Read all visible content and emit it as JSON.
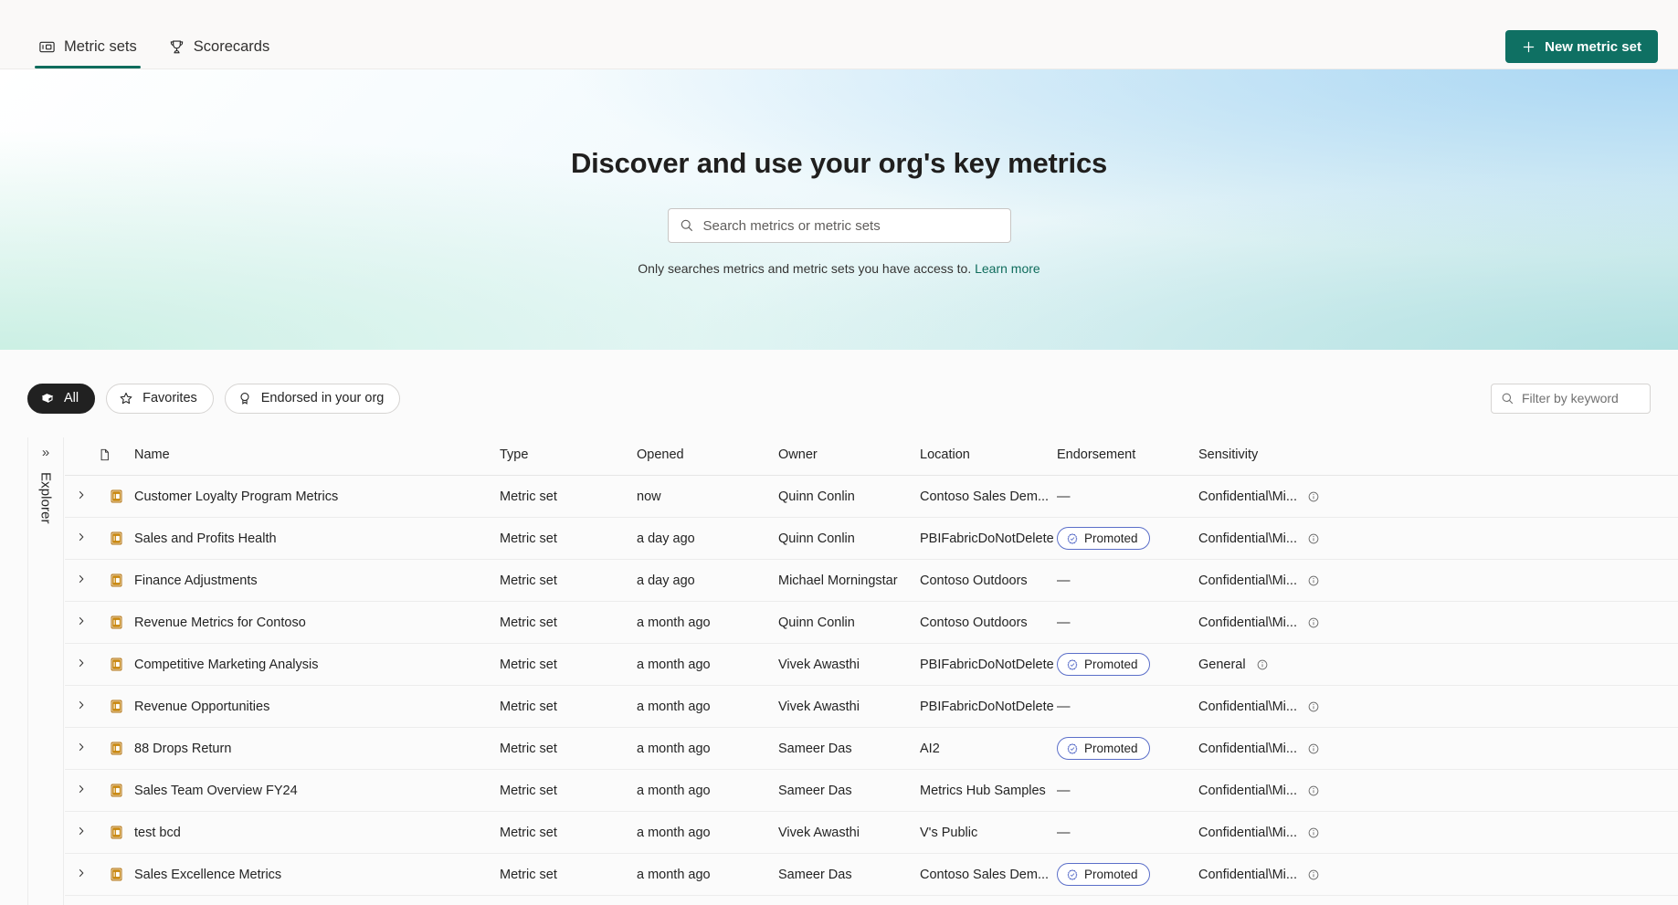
{
  "header": {
    "tabs": [
      {
        "label": "Metric sets",
        "icon": "metric-set-icon",
        "active": true
      },
      {
        "label": "Scorecards",
        "icon": "trophy-icon",
        "active": false
      }
    ],
    "new_button": {
      "label": "New metric set",
      "icon": "plus-icon",
      "color": "#0f7063"
    }
  },
  "hero": {
    "title": "Discover and use your org's key metrics",
    "search": {
      "placeholder": "Search metrics or metric sets",
      "value": "",
      "icon": "search-icon"
    },
    "note_text": "Only searches metrics and metric sets you have access to.",
    "note_link": "Learn more",
    "link_color": "#0f6c5c"
  },
  "explorer": {
    "label": "Explorer",
    "expand_icon": "chevron-double-right-icon"
  },
  "filters": {
    "pills": [
      {
        "label": "All",
        "icon": "collection-icon",
        "active": true
      },
      {
        "label": "Favorites",
        "icon": "star-icon",
        "active": false
      },
      {
        "label": "Endorsed in your org",
        "icon": "badge-icon",
        "active": false
      }
    ],
    "keyword": {
      "placeholder": "Filter by keyword",
      "value": "",
      "icon": "search-icon"
    }
  },
  "table": {
    "columns": [
      "",
      "",
      "Name",
      "Type",
      "Opened",
      "Owner",
      "Location",
      "Endorsement",
      "Sensitivity"
    ],
    "headers": {
      "name": "Name",
      "type": "Type",
      "opened": "Opened",
      "owner": "Owner",
      "location": "Location",
      "endorsement": "Endorsement",
      "sensitivity": "Sensitivity"
    },
    "rows": [
      {
        "name": "Customer Loyalty Program Metrics",
        "type": "Metric set",
        "opened": "now",
        "owner": "Quinn Conlin",
        "location": "Contoso Sales Dem...",
        "endorsement": "—",
        "sensitivity": "Confidential\\Mi..."
      },
      {
        "name": "Sales and Profits Health",
        "type": "Metric set",
        "opened": "a day ago",
        "owner": "Quinn Conlin",
        "location": "PBIFabricDoNotDelete",
        "endorsement": "Promoted",
        "sensitivity": "Confidential\\Mi..."
      },
      {
        "name": "Finance Adjustments",
        "type": "Metric set",
        "opened": "a day ago",
        "owner": "Michael Morningstar",
        "location": "Contoso Outdoors",
        "endorsement": "—",
        "sensitivity": "Confidential\\Mi..."
      },
      {
        "name": "Revenue Metrics for Contoso",
        "type": "Metric set",
        "opened": "a month ago",
        "owner": "Quinn Conlin",
        "location": "Contoso Outdoors",
        "endorsement": "—",
        "sensitivity": "Confidential\\Mi..."
      },
      {
        "name": "Competitive Marketing Analysis",
        "type": "Metric set",
        "opened": "a month ago",
        "owner": "Vivek Awasthi",
        "location": "PBIFabricDoNotDelete",
        "endorsement": "Promoted",
        "sensitivity": "General"
      },
      {
        "name": "Revenue Opportunities",
        "type": "Metric set",
        "opened": "a month ago",
        "owner": "Vivek Awasthi",
        "location": "PBIFabricDoNotDelete",
        "endorsement": "—",
        "sensitivity": "Confidential\\Mi..."
      },
      {
        "name": "88 Drops Return",
        "type": "Metric set",
        "opened": "a month ago",
        "owner": "Sameer Das",
        "location": "AI2",
        "endorsement": "Promoted",
        "sensitivity": "Confidential\\Mi..."
      },
      {
        "name": "Sales Team Overview FY24",
        "type": "Metric set",
        "opened": "a month ago",
        "owner": "Sameer Das",
        "location": "Metrics Hub Samples",
        "endorsement": "—",
        "sensitivity": "Confidential\\Mi..."
      },
      {
        "name": "test bcd",
        "type": "Metric set",
        "opened": "a month ago",
        "owner": "Vivek Awasthi",
        "location": "V's Public",
        "endorsement": "—",
        "sensitivity": "Confidential\\Mi..."
      },
      {
        "name": "Sales Excellence Metrics",
        "type": "Metric set",
        "opened": "a month ago",
        "owner": "Sameer Das",
        "location": "Contoso Sales Dem...",
        "endorsement": "Promoted",
        "sensitivity": "Confidential\\Mi..."
      }
    ]
  },
  "colors": {
    "accent_green": "#0f7063",
    "metric_icon_gold": "#b2700a",
    "endorsed_border": "#5b6fc9"
  }
}
